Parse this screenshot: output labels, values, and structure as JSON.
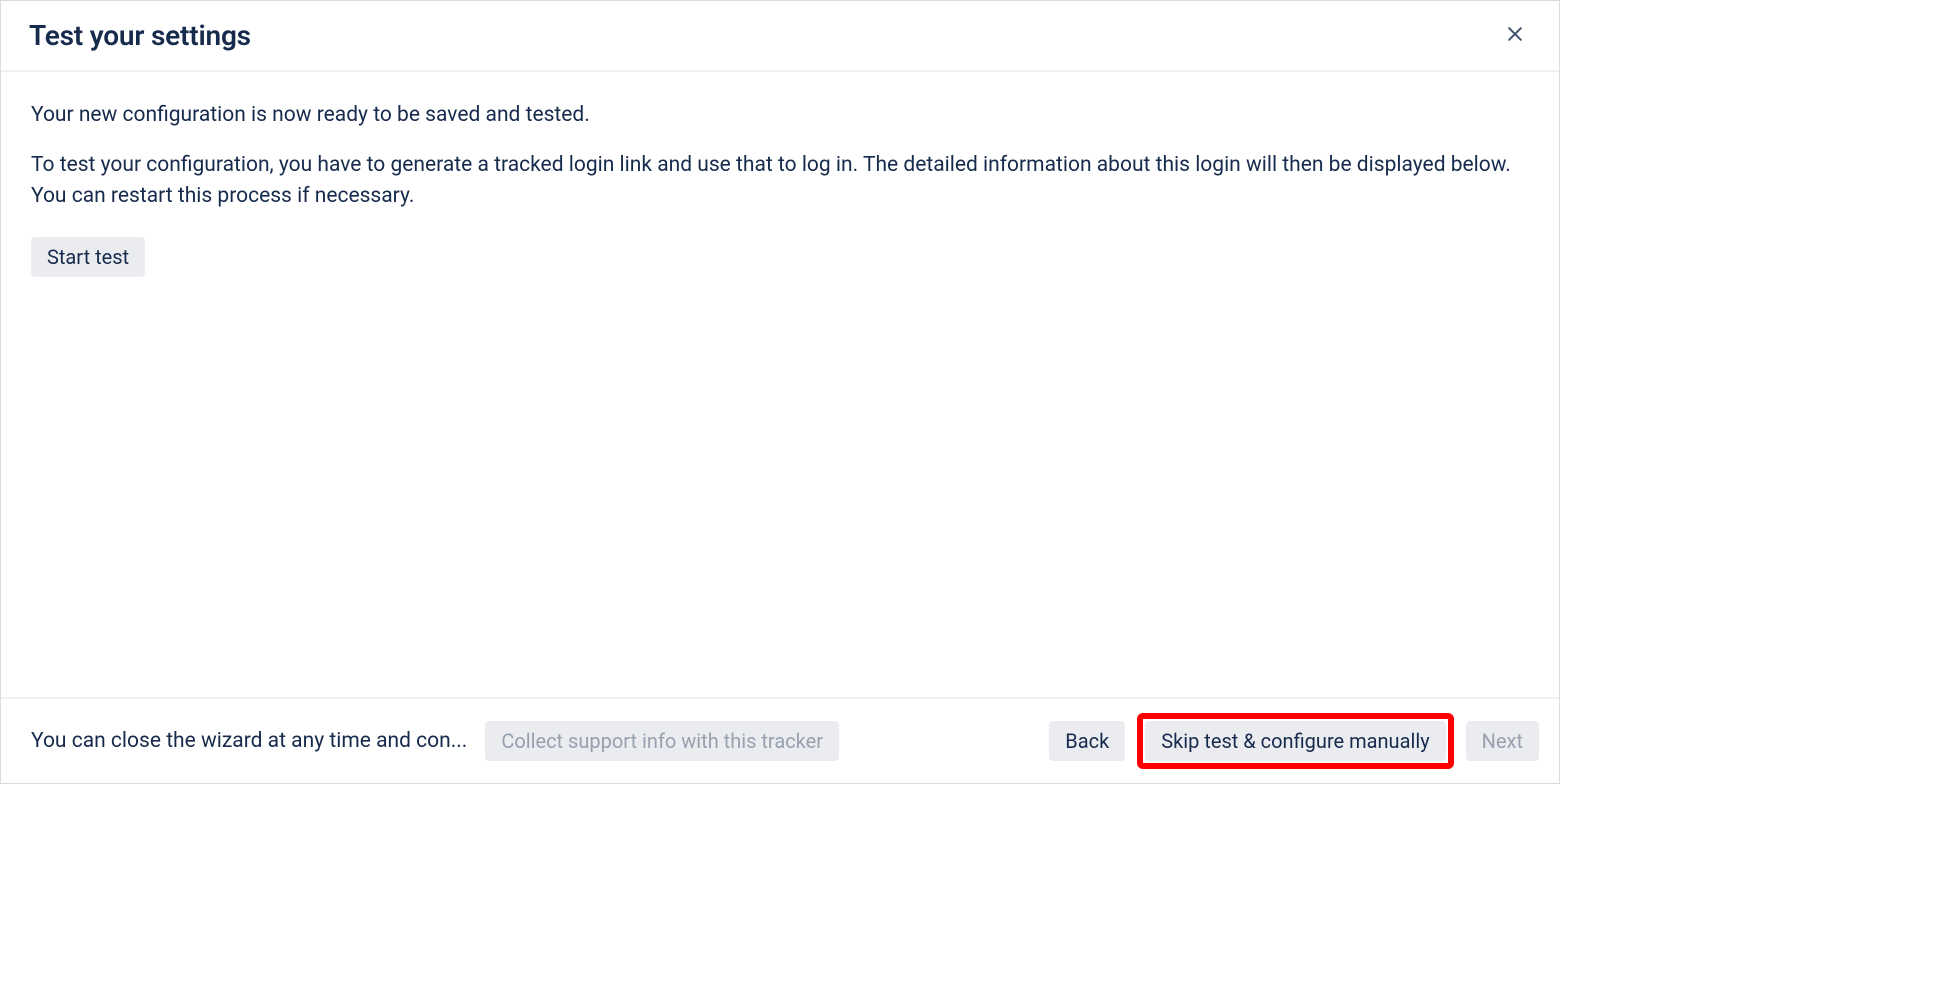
{
  "header": {
    "title": "Test your settings"
  },
  "body": {
    "paragraph1": "Your new configuration is now ready to be saved and tested.",
    "paragraph2": "To test your configuration, you have to generate a tracked login link and use that to log in. The detailed information about this login will then be displayed below. You can restart this process if necessary.",
    "start_test_label": "Start test"
  },
  "footer": {
    "note": "You can close the wizard at any time and con...",
    "collect_label": "Collect support info with this tracker",
    "back_label": "Back",
    "skip_label": "Skip test & configure manually",
    "next_label": "Next"
  }
}
